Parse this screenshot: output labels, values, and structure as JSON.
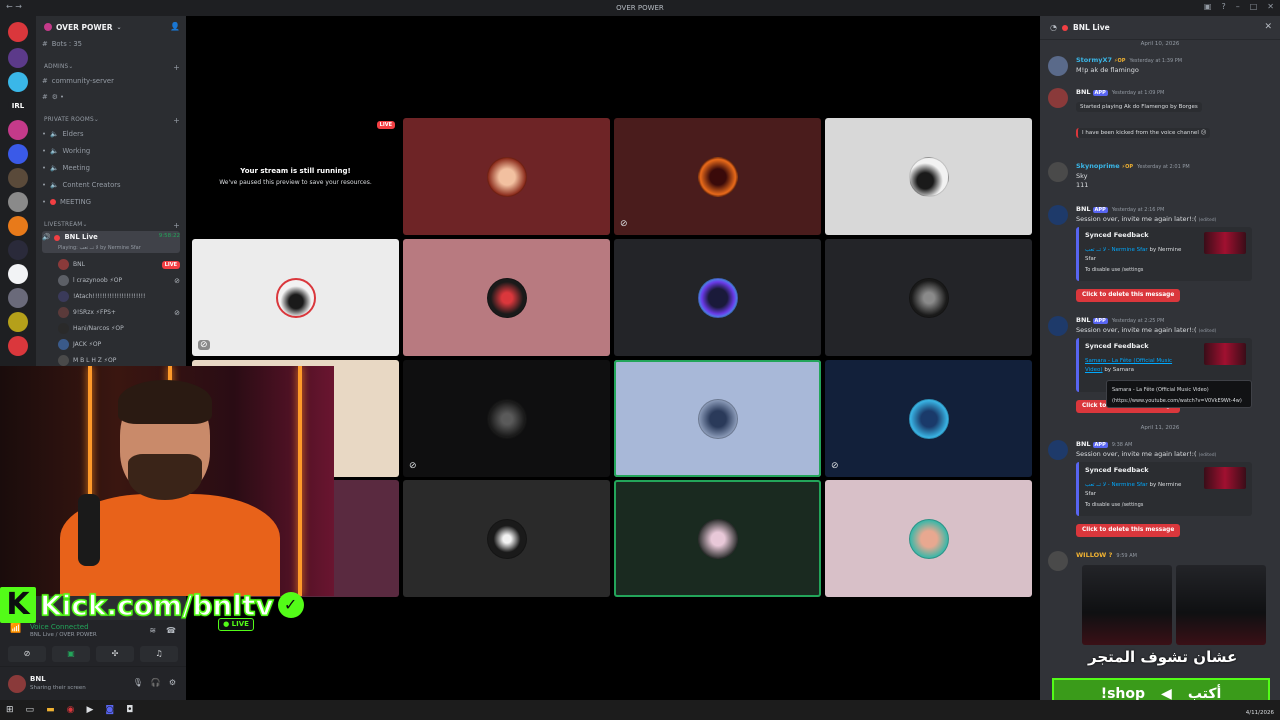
{
  "window": {
    "title": "OVER POWER"
  },
  "server": {
    "name": "OVER POWER",
    "bots_label": "Bots : 35"
  },
  "categories": {
    "admins": "ADMINS",
    "private_rooms": "PRIVATE ROOMS",
    "livestream": "LIVESTREAM"
  },
  "admin_channels": [
    {
      "label": "community-server"
    },
    {
      "label": "⚙ •"
    }
  ],
  "private_channels": [
    {
      "label": "Elders"
    },
    {
      "label": "Working"
    },
    {
      "label": "Meeting"
    },
    {
      "label": "Content Creators"
    },
    {
      "label": "MEETING"
    }
  ],
  "live_channel": {
    "label": "BNL Live",
    "activity": "Playing: لا تــ تعب by Nermine Sfar",
    "timer": "9:58:22"
  },
  "voice_members": [
    {
      "name": "BNL",
      "badge": "LIVE"
    },
    {
      "name": "l crazynoob ⚡OP",
      "badge": ""
    },
    {
      "name": "!Atach!!!!!!!!!!!!!!!!!!!!!!",
      "badge": ""
    },
    {
      "name": "9!SRzx ⚡FPS+",
      "badge": ""
    },
    {
      "name": "Hani/Narcos ⚡OP",
      "badge": ""
    },
    {
      "name": "JACK ⚡OP",
      "badge": ""
    },
    {
      "name": "M B L H Z ⚡OP",
      "badge": ""
    }
  ],
  "stream": {
    "paused_title": "Your stream is still running!",
    "paused_sub": "We've paused this preview to save your resources.",
    "live_badge": "LIVE"
  },
  "kick": {
    "url": "Kick.com/bnltv",
    "live": "LIVE",
    "k": "K",
    "check": "✓"
  },
  "voice_panel": {
    "status": "Voice Connected",
    "channel": "BNL Live / OVER POWER"
  },
  "user": {
    "name": "BNL",
    "status": "Sharing their screen"
  },
  "chat": {
    "title": "BNL Live",
    "dates": [
      "April 10, 2026",
      "April 11, 2026"
    ],
    "messages": [
      {
        "author": "StormyX7",
        "tag": "⚡OP",
        "time": "Yesterday at 1:39 PM",
        "text": "M!p ak de flamingo"
      },
      {
        "author": "BNL",
        "tag": "APP",
        "time": "Yesterday at 1:09 PM",
        "text": "Started playing Ak do Flamengo by Borges",
        "kicked": "I have been kicked from the voice channel 😕"
      },
      {
        "author": "Skynoprime",
        "tag": "⚡OP",
        "time": "Yesterday at 2:01 PM",
        "text": "Sky",
        "text2": "111"
      },
      {
        "author": "BNL",
        "tag": "APP",
        "time": "Yesterday at 2:16 PM",
        "text": "Session over, invite me again later!:(",
        "edited": "(edited)"
      },
      {
        "author": "BNL",
        "tag": "APP",
        "time": "Yesterday at 2:25 PM",
        "text": "Session over, invite me again later!:(",
        "edited": "(edited)"
      },
      {
        "author": "BNL",
        "tag": "APP",
        "time": "9:38 AM",
        "text": "Session over, invite me again later!:(",
        "edited": "(edited)"
      },
      {
        "author": "WILLOW ?",
        "tag": "",
        "time": "9:59 AM",
        "text": ""
      }
    ],
    "embed_title": "Synced Feedback",
    "embed_song1": "لا تــ تعب - Nermine Sfar",
    "embed_by1": "by Nermine",
    "embed_sfar": "Sfar",
    "embed_song2": "Samara - La Fête (Official Music",
    "embed_video": "Video)",
    "embed_by2": "by Samara",
    "embed_hint": "To disable use /settings",
    "delete_btn": "Click to delete this message",
    "tooltip_line1": "Samara - La Fête (Official Music Video)",
    "tooltip_line2": "(https://www.youtube.com/watch?v=V0VkE9Wt-4w)"
  },
  "shop": {
    "arabic_top": "عشان تشوف المتجر",
    "cmd": "!shop",
    "arabic_btn": "أكتب"
  },
  "taskbar": {
    "date": "4/11/2026"
  },
  "colors": {
    "bg_sidebar": "#2b2d31",
    "bg_chat": "#313338",
    "accent": "#5865f2",
    "live_red": "#f23f43",
    "kick_green": "#53fc18",
    "voice_green": "#23a55a"
  }
}
